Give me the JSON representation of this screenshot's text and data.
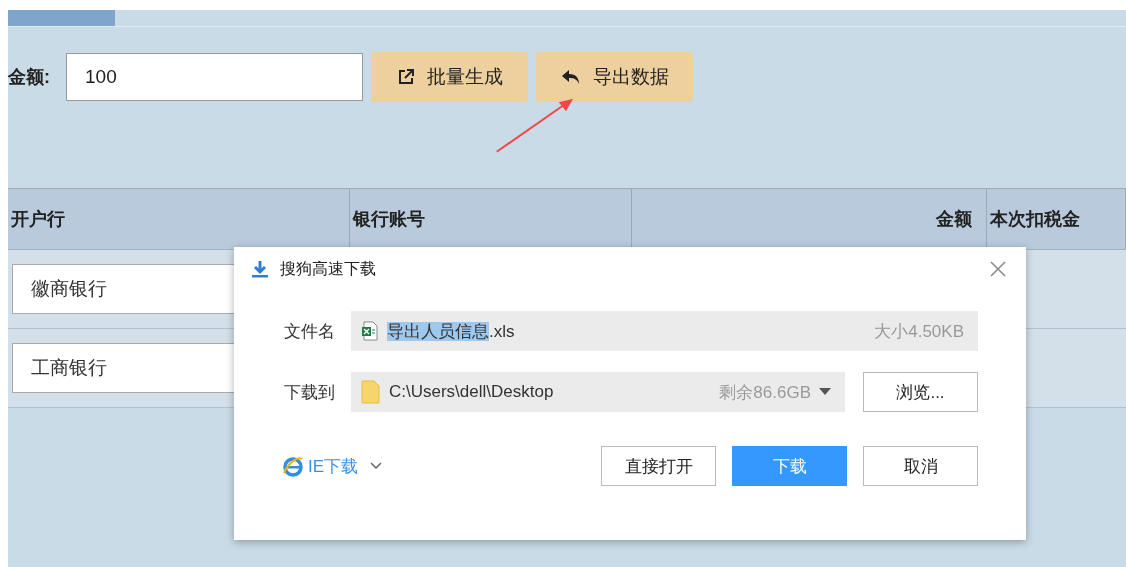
{
  "form": {
    "label": "金额:",
    "amount": "100"
  },
  "buttons": [
    {
      "kind": "external",
      "label": "批量生成"
    },
    {
      "kind": "reply",
      "label": "导出数据"
    }
  ],
  "table": {
    "columns": [
      {
        "label": "开户行",
        "kind": "text"
      },
      {
        "label": "银行账号",
        "kind": "text"
      },
      {
        "label": "金额",
        "kind": "number"
      },
      {
        "label": "本次扣税金",
        "kind": "text"
      }
    ],
    "rows": [
      {
        "bank": "徽商银行"
      },
      {
        "bank": "工商银行"
      }
    ]
  },
  "dialog": {
    "title": "搜狗高速下载",
    "file_label": "文件名",
    "file_name_selected": "导出人员信息",
    "file_name_rest": ".xls",
    "file_size": "大小4.50KB",
    "dest_label": "下载到",
    "dest_path": "C:\\Users\\dell\\Desktop",
    "free_space": "剩余86.6GB",
    "browse": "浏览...",
    "ie_download": "IE下载",
    "buttons": [
      {
        "kind": "secondary",
        "label": "直接打开"
      },
      {
        "kind": "primary",
        "label": "下载"
      },
      {
        "kind": "secondary",
        "label": "取消"
      }
    ]
  }
}
